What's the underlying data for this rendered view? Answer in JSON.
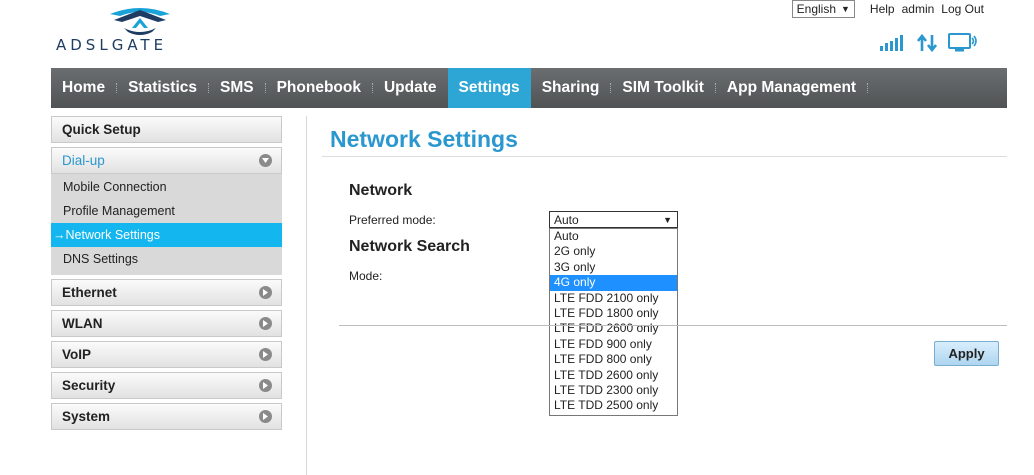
{
  "brand": {
    "logo_text": "ADSLGATE"
  },
  "topbar": {
    "language": "English",
    "help": "Help",
    "user": "admin",
    "logout": "Log Out"
  },
  "status_icons": [
    "signal-icon",
    "data-transfer-icon",
    "pc-connection-icon"
  ],
  "nav": {
    "items": [
      "Home",
      "Statistics",
      "SMS",
      "Phonebook",
      "Update",
      "Settings",
      "Sharing",
      "SIM Toolkit",
      "App Management"
    ],
    "active": "Settings"
  },
  "sidebar": {
    "quick_setup": "Quick Setup",
    "dialup": "Dial-up",
    "dialup_items": [
      "Mobile Connection",
      "Profile Management",
      "Network Settings",
      "DNS Settings"
    ],
    "active_item": "Network Settings",
    "active_prefix": "→",
    "ethernet": "Ethernet",
    "wlan": "WLAN",
    "voip": "VoIP",
    "security": "Security",
    "system": "System"
  },
  "main": {
    "title": "Network Settings",
    "network_heading": "Network",
    "preferred_mode_label": "Preferred mode:",
    "preferred_mode_value": "Auto",
    "network_search_heading": "Network Search",
    "mode_label": "Mode:",
    "options": [
      "Auto",
      "2G only",
      "3G only",
      "4G only",
      "LTE FDD 2100 only",
      "LTE FDD 1800 only",
      "LTE FDD 2600 only",
      "LTE FDD 900 only",
      "LTE FDD 800 only",
      "LTE TDD 2600 only",
      "LTE TDD 2300 only",
      "LTE TDD 2500 only"
    ],
    "highlighted_option": "4G only",
    "apply": "Apply"
  },
  "colors": {
    "accent": "#2a97cf",
    "nav_bg": "#5e6163",
    "nav_active": "#2da6d6",
    "sidebar_active": "#13b6ef",
    "option_highlight": "#1e90ff"
  }
}
